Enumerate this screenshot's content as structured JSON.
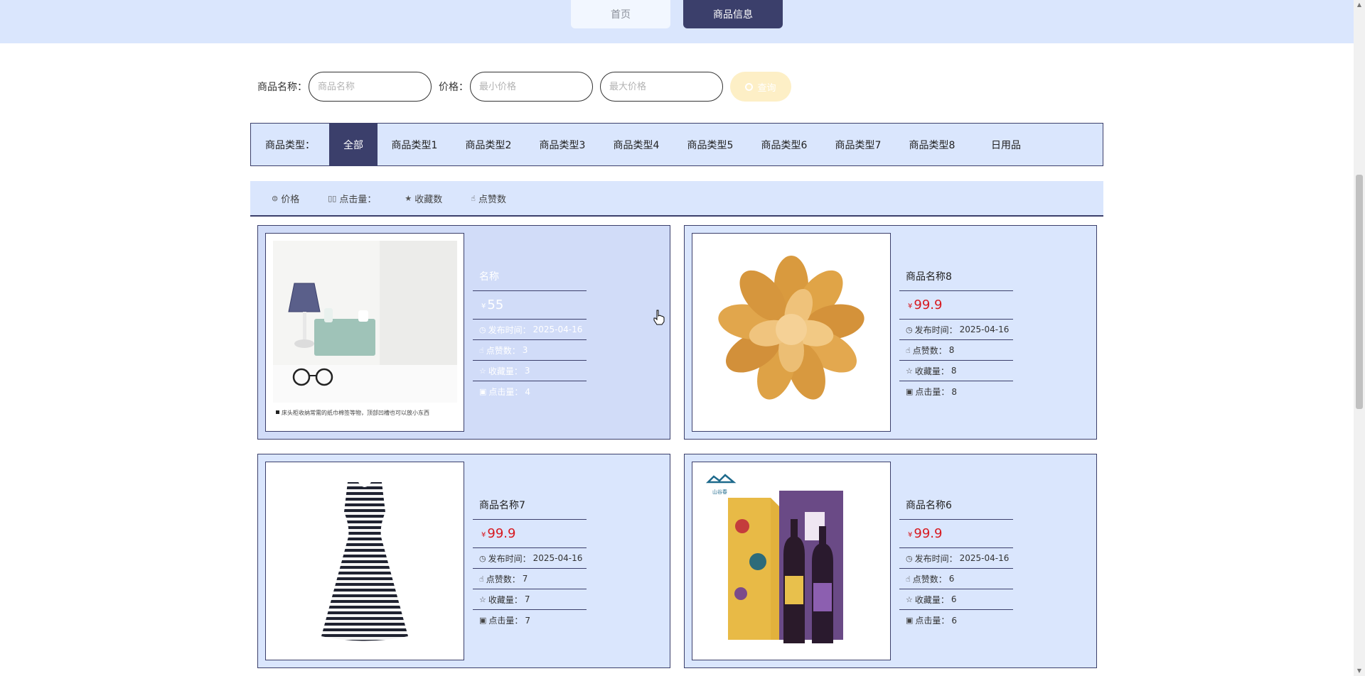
{
  "nav": {
    "home": "首页",
    "goods": "商品信息"
  },
  "search": {
    "name_label": "商品名称：",
    "name_placeholder": "商品名称",
    "price_label": "价格：",
    "min_placeholder": "最小价格",
    "max_placeholder": "最大价格",
    "query_label": "查询"
  },
  "category": {
    "label": "商品类型：",
    "items": [
      "全部",
      "商品类型1",
      "商品类型2",
      "商品类型3",
      "商品类型4",
      "商品类型5",
      "商品类型6",
      "商品类型7",
      "商品类型8",
      "日用品"
    ],
    "active": "全部"
  },
  "sort": {
    "price": "价格",
    "clicks": "点击量：",
    "favorites": "收藏数",
    "likes": "点赞数"
  },
  "products": [
    {
      "name": "名称",
      "currency": "¥",
      "price": "55",
      "time_label": "发布时间：",
      "time": "2025-04-16",
      "likes_label": "点赞数：",
      "likes": "3",
      "fav_label": "收藏量：",
      "fav": "3",
      "clicks_label": "点击量：",
      "clicks": "4",
      "image_caption": "床头柜收纳常需的纸巾棉签等物，顶部凹槽也可以放小东西"
    },
    {
      "name": "商品名称8",
      "currency": "¥",
      "price": "99.9",
      "time_label": "发布时间：",
      "time": "2025-04-16",
      "likes_label": "点赞数：",
      "likes": "8",
      "fav_label": "收藏量：",
      "fav": "8",
      "clicks_label": "点击量：",
      "clicks": "8"
    },
    {
      "name": "商品名称7",
      "currency": "¥",
      "price": "99.9",
      "time_label": "发布时间：",
      "time": "2025-04-16",
      "likes_label": "点赞数：",
      "likes": "7",
      "fav_label": "收藏量：",
      "fav": "7",
      "clicks_label": "点击量：",
      "clicks": "7"
    },
    {
      "name": "商品名称6",
      "currency": "¥",
      "price": "99.9",
      "time_label": "发布时间：",
      "time": "2025-04-16",
      "likes_label": "点赞数：",
      "likes": "6",
      "fav_label": "收藏量：",
      "fav": "6",
      "clicks_label": "点击量：",
      "clicks": "6",
      "image_brand": "山谷春"
    }
  ],
  "colors": {
    "accent": "#3b3f6b",
    "panel": "#dae6fd",
    "price": "#d71920",
    "query_button": "#fdefc6"
  }
}
